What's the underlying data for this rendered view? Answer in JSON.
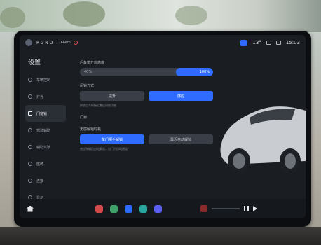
{
  "status": {
    "brand": "PGND",
    "range": "766km",
    "temperature": "13°",
    "time": "15:03"
  },
  "page_title": "设置",
  "sidebar": {
    "items": [
      {
        "label": "车辆控制",
        "icon": "car-control-icon",
        "active": false
      },
      {
        "label": "灯光",
        "icon": "light-icon",
        "active": false
      },
      {
        "label": "门窗锁",
        "icon": "door-lock-icon",
        "active": true
      },
      {
        "label": "驾驶辅助",
        "icon": "steering-icon",
        "active": false
      },
      {
        "label": "辅助驾驶",
        "icon": "assist-icon",
        "active": false
      },
      {
        "label": "座椅",
        "icon": "seat-icon",
        "active": false
      },
      {
        "label": "连接",
        "icon": "link-icon",
        "active": false
      },
      {
        "label": "显示",
        "icon": "display-icon",
        "active": false
      }
    ]
  },
  "content": {
    "section1_label": "后备箱开启高度",
    "slider": {
      "low_label": "40%",
      "high_label": "100%",
      "fraction": 0.28
    },
    "section2_label": "闭锁方式",
    "seg1": {
      "opt1": "提升",
      "opt2": "感应"
    },
    "hint1": "解锁后车辆接近感应闭锁功能",
    "section3_label": "门锁",
    "section4_label": "无感解锁时机",
    "seg2": {
      "opt1": "车门把手解锁",
      "opt2": "靠近自动解锁"
    },
    "hint2": "感应车辆后自动解锁，出门时自动闭锁"
  },
  "colors": {
    "accent": "#2f6bff",
    "screen_bg": "#1a1d22"
  },
  "dock": {
    "apps": [
      "home-icon",
      "app-grid-icon",
      "camera-icon",
      "video-icon",
      "music-icon",
      "apps-icon"
    ]
  }
}
